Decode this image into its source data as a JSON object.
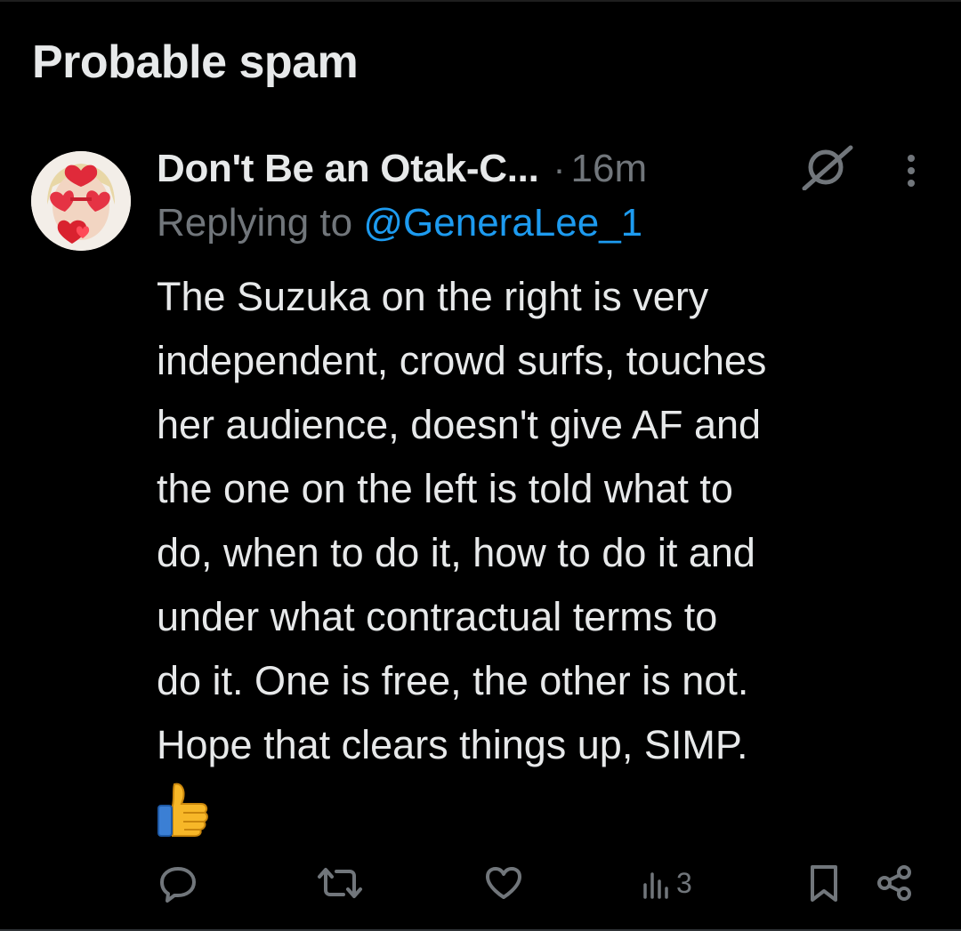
{
  "section": {
    "title": "Probable spam"
  },
  "tweet": {
    "display_name": "Don't Be an Otak-C...",
    "separator": "·",
    "timestamp": "16m",
    "replying_prefix": "Replying to",
    "replying_handle": "@GeneraLee_1",
    "body_lines": [
      "The Suzuka on the right is very",
      "independent, crowd surfs, touches",
      "her audience, doesn't give AF and",
      "the one on the left is told what to",
      "do, when to do it, how to do it and",
      "under what contractual terms to",
      "do it. One is free, the other is not.",
      "Hope that clears things up, SIMP."
    ]
  },
  "actions": {
    "reply_icon": "speech-bubble-icon",
    "repost_icon": "repost-arrows-icon",
    "like_icon": "heart-icon",
    "views_icon": "bar-chart-icon",
    "views_count": "3",
    "bookmark_icon": "bookmark-icon",
    "share_icon": "share-nodes-icon"
  },
  "colors": {
    "background": "#000000",
    "text_primary": "#e7e9ea",
    "text_secondary": "#71767b",
    "link": "#1d9bf0"
  }
}
